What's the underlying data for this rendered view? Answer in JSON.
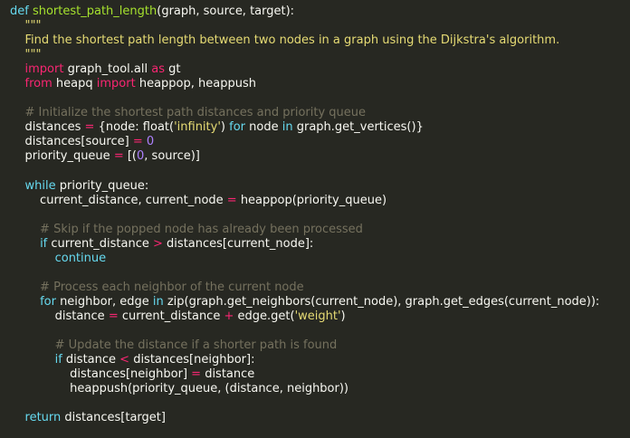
{
  "editor": {
    "colors": {
      "background": "#272822",
      "plain": "#f8f8f2",
      "keyword": "#66d9ef",
      "import_keyword": "#f92672",
      "function_name": "#a6e22e",
      "string": "#e6db74",
      "comment": "#75715e",
      "operator": "#f92672",
      "number": "#ae81ff"
    },
    "lines": [
      [
        {
          "t": "kw",
          "v": "def"
        },
        {
          "t": "pl",
          "v": " "
        },
        {
          "t": "fn",
          "v": "shortest_path_length"
        },
        {
          "t": "pl",
          "v": "(graph, source, target):"
        }
      ],
      [
        {
          "t": "str",
          "v": "    \"\"\""
        }
      ],
      [
        {
          "t": "str",
          "v": "    Find the shortest path length between two nodes in a graph using the Dijkstra's algorithm."
        }
      ],
      [
        {
          "t": "str",
          "v": "    \"\"\""
        }
      ],
      [
        {
          "t": "pl",
          "v": "    "
        },
        {
          "t": "imp",
          "v": "import"
        },
        {
          "t": "pl",
          "v": " graph_tool.all "
        },
        {
          "t": "imp",
          "v": "as"
        },
        {
          "t": "pl",
          "v": " gt"
        }
      ],
      [
        {
          "t": "pl",
          "v": "    "
        },
        {
          "t": "imp",
          "v": "from"
        },
        {
          "t": "pl",
          "v": " heapq "
        },
        {
          "t": "imp",
          "v": "import"
        },
        {
          "t": "pl",
          "v": " heappop, heappush"
        }
      ],
      [
        {
          "t": "pl",
          "v": ""
        }
      ],
      [
        {
          "t": "cm",
          "v": "    # Initialize the shortest path distances and priority queue"
        }
      ],
      [
        {
          "t": "pl",
          "v": "    distances "
        },
        {
          "t": "op",
          "v": "="
        },
        {
          "t": "pl",
          "v": " {node: float("
        },
        {
          "t": "str",
          "v": "'infinity'"
        },
        {
          "t": "pl",
          "v": ") "
        },
        {
          "t": "kw",
          "v": "for"
        },
        {
          "t": "pl",
          "v": " node "
        },
        {
          "t": "kw",
          "v": "in"
        },
        {
          "t": "pl",
          "v": " graph.get_vertices()}"
        }
      ],
      [
        {
          "t": "pl",
          "v": "    distances[source] "
        },
        {
          "t": "op",
          "v": "="
        },
        {
          "t": "pl",
          "v": " "
        },
        {
          "t": "num",
          "v": "0"
        }
      ],
      [
        {
          "t": "pl",
          "v": "    priority_queue "
        },
        {
          "t": "op",
          "v": "="
        },
        {
          "t": "pl",
          "v": " [("
        },
        {
          "t": "num",
          "v": "0"
        },
        {
          "t": "pl",
          "v": ", source)]"
        }
      ],
      [
        {
          "t": "pl",
          "v": ""
        }
      ],
      [
        {
          "t": "pl",
          "v": "    "
        },
        {
          "t": "kw",
          "v": "while"
        },
        {
          "t": "pl",
          "v": " priority_queue:"
        }
      ],
      [
        {
          "t": "pl",
          "v": "        current_distance, current_node "
        },
        {
          "t": "op",
          "v": "="
        },
        {
          "t": "pl",
          "v": " heappop(priority_queue)"
        }
      ],
      [
        {
          "t": "pl",
          "v": ""
        }
      ],
      [
        {
          "t": "cm",
          "v": "        # Skip if the popped node has already been processed"
        }
      ],
      [
        {
          "t": "pl",
          "v": "        "
        },
        {
          "t": "kw",
          "v": "if"
        },
        {
          "t": "pl",
          "v": " current_distance "
        },
        {
          "t": "op",
          "v": ">"
        },
        {
          "t": "pl",
          "v": " distances[current_node]:"
        }
      ],
      [
        {
          "t": "pl",
          "v": "            "
        },
        {
          "t": "kw",
          "v": "continue"
        }
      ],
      [
        {
          "t": "pl",
          "v": ""
        }
      ],
      [
        {
          "t": "cm",
          "v": "        # Process each neighbor of the current node"
        }
      ],
      [
        {
          "t": "pl",
          "v": "        "
        },
        {
          "t": "kw",
          "v": "for"
        },
        {
          "t": "pl",
          "v": " neighbor, edge "
        },
        {
          "t": "kw",
          "v": "in"
        },
        {
          "t": "pl",
          "v": " zip(graph.get_neighbors(current_node), graph.get_edges(current_node)):"
        }
      ],
      [
        {
          "t": "pl",
          "v": "            distance "
        },
        {
          "t": "op",
          "v": "="
        },
        {
          "t": "pl",
          "v": " current_distance "
        },
        {
          "t": "op",
          "v": "+"
        },
        {
          "t": "pl",
          "v": " edge.get("
        },
        {
          "t": "str",
          "v": "'weight'"
        },
        {
          "t": "pl",
          "v": ")"
        }
      ],
      [
        {
          "t": "pl",
          "v": ""
        }
      ],
      [
        {
          "t": "cm",
          "v": "            # Update the distance if a shorter path is found"
        }
      ],
      [
        {
          "t": "pl",
          "v": "            "
        },
        {
          "t": "kw",
          "v": "if"
        },
        {
          "t": "pl",
          "v": " distance "
        },
        {
          "t": "op",
          "v": "<"
        },
        {
          "t": "pl",
          "v": " distances[neighbor]:"
        }
      ],
      [
        {
          "t": "pl",
          "v": "                distances[neighbor] "
        },
        {
          "t": "op",
          "v": "="
        },
        {
          "t": "pl",
          "v": " distance"
        }
      ],
      [
        {
          "t": "pl",
          "v": "                heappush(priority_queue, (distance, neighbor))"
        }
      ],
      [
        {
          "t": "pl",
          "v": ""
        }
      ],
      [
        {
          "t": "pl",
          "v": "    "
        },
        {
          "t": "kw",
          "v": "return"
        },
        {
          "t": "pl",
          "v": " distances[target]"
        }
      ]
    ]
  }
}
